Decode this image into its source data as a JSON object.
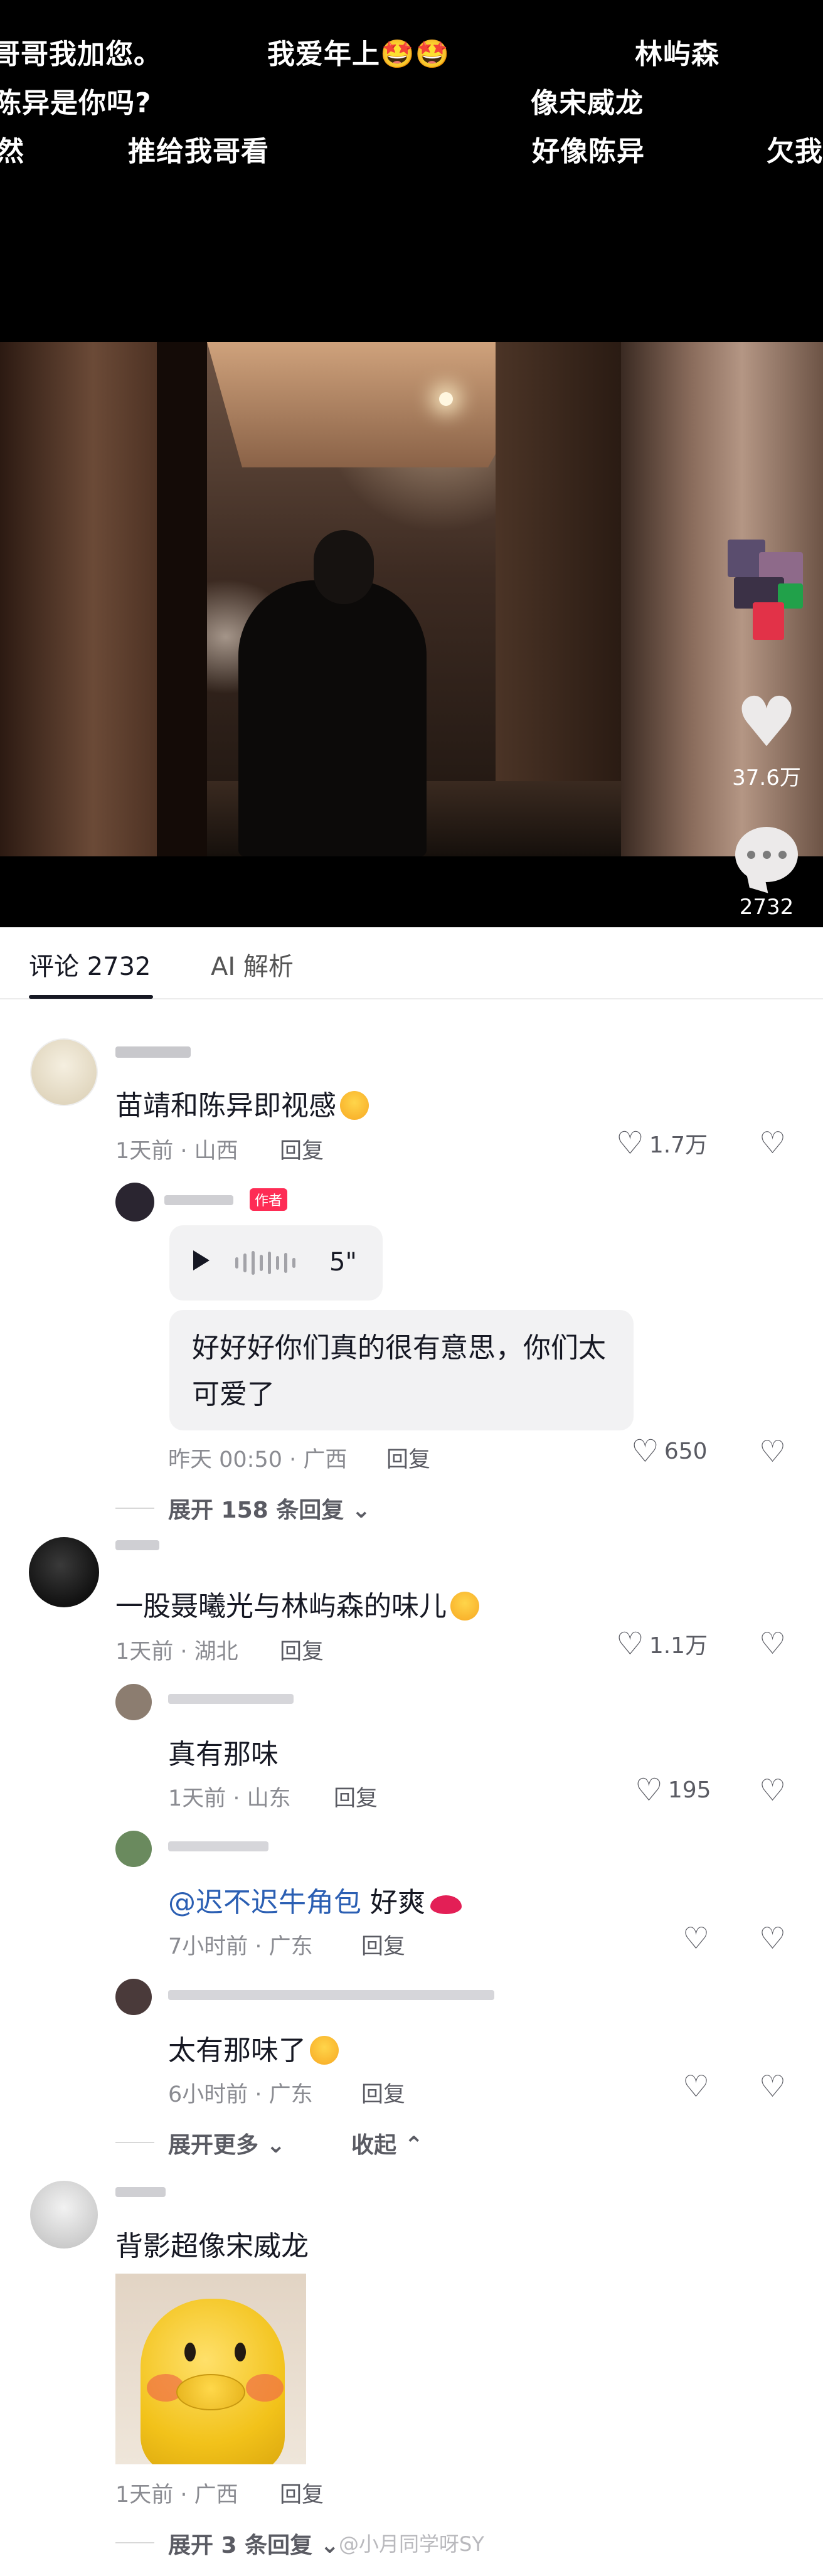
{
  "danmaku": [
    {
      "text": "哥哥我加您。"
    },
    {
      "text": "我爱年上🤩🤩"
    },
    {
      "text": "林屿森"
    },
    {
      "text": "陈异是你吗?"
    },
    {
      "text": "像宋威龙"
    },
    {
      "text": "然"
    },
    {
      "text": "推给我哥看"
    },
    {
      "text": "好像陈异"
    },
    {
      "text": "欠我"
    }
  ],
  "video": {
    "likes": "37.6万",
    "comments": "2732"
  },
  "tabs": [
    {
      "label": "评论 2732",
      "active": true
    },
    {
      "label": "AI 解析",
      "active": false
    }
  ],
  "comments": [
    {
      "text": "苗靖和陈异即视感",
      "time_location": "1天前 · 山西",
      "reply_label": "回复",
      "likes": "1.7万",
      "replies": [
        {
          "author_tag": "作者",
          "voice_duration": "5\"",
          "text": "好好好你们真的很有意思，你们太可爱了",
          "time_location": "昨天 00:50 · 广西",
          "reply_label": "回复",
          "likes": "650"
        }
      ],
      "expand_label": "展开 158 条回复"
    },
    {
      "text": "一股聂曦光与林屿森的味儿",
      "time_location": "1天前 · 湖北",
      "reply_label": "回复",
      "likes": "1.1万",
      "replies": [
        {
          "text": "真有那味",
          "time_location": "1天前 · 山东",
          "reply_label": "回复",
          "likes": "195"
        },
        {
          "mention": "@迟不迟牛角包",
          "text": "好爽",
          "time_location": "7小时前 · 广东",
          "reply_label": "回复"
        },
        {
          "text": "太有那味了",
          "time_location": "6小时前 · 广东",
          "reply_label": "回复"
        }
      ],
      "expand_label": "展开更多",
      "collapse_label": "收起"
    },
    {
      "text": "背影超像宋威龙",
      "time_location": "1天前 · 广西",
      "reply_label": "回复",
      "expand_label": "展开 3 条回复"
    }
  ],
  "watermark": "@小月同学呀SY",
  "icons": {
    "like": "heart-outline-icon",
    "dislike": "broken-heart-icon",
    "play": "play-icon",
    "expand": "chevron-down-icon",
    "collapse": "chevron-up-icon"
  },
  "colors": {
    "accent": "#fe2c55",
    "mention": "#2b5fb3",
    "text_primary": "#161823",
    "text_secondary": "#8a8b91"
  }
}
